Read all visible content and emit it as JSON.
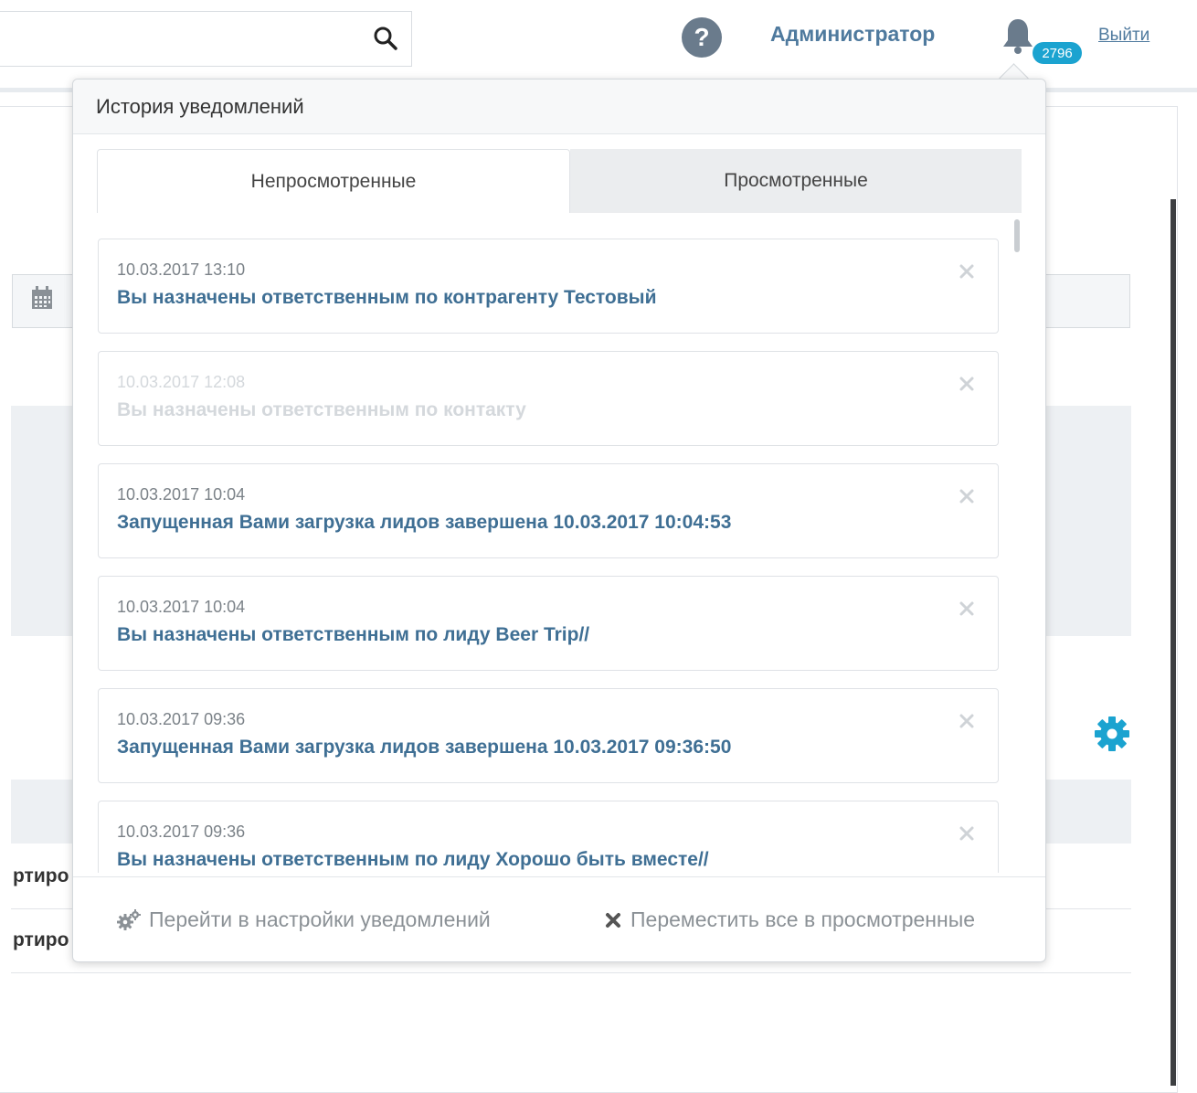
{
  "topbar": {
    "user_name": "Администратор",
    "notification_count": "2796",
    "logout_label": "Выйти"
  },
  "notifications_popover": {
    "title": "История уведомлений",
    "tabs": [
      {
        "label": "Непросмотренные",
        "active": true
      },
      {
        "label": "Просмотренные",
        "active": false
      }
    ],
    "items": [
      {
        "time": "10.03.2017 13:10",
        "text": "Вы назначены ответственным по контрагенту Тестовый",
        "dimmed": false
      },
      {
        "time": "10.03.2017 12:08",
        "text": "Вы назначены ответственным по контакту",
        "dimmed": true
      },
      {
        "time": "10.03.2017 10:04",
        "text": "Запущенная Вами загрузка лидов завершена 10.03.2017 10:04:53",
        "dimmed": false
      },
      {
        "time": "10.03.2017 10:04",
        "text": "Вы назначены ответственным по лиду Beer Trip//",
        "dimmed": false
      },
      {
        "time": "10.03.2017 09:36",
        "text": "Запущенная Вами загрузка лидов завершена 10.03.2017 09:36:50",
        "dimmed": false
      },
      {
        "time": "10.03.2017 09:36",
        "text": "Вы назначены ответственным по лиду Хорошо быть вместе//",
        "dimmed": false
      }
    ],
    "footer": {
      "settings_label": "Перейти в настройки уведомлений",
      "mark_all_read_label": "Переместить все в просмотренные"
    }
  },
  "background": {
    "table_rows": [
      "ртиро",
      "ртиро"
    ]
  },
  "colors": {
    "link": "#3f6f94",
    "badge": "#1ba3d0",
    "gear": "#1ba3d0"
  },
  "icons": [
    "search-icon",
    "help-icon",
    "bell-icon",
    "calendar-icon",
    "gear-icon",
    "close-icon",
    "gears-icon",
    "x-icon"
  ]
}
